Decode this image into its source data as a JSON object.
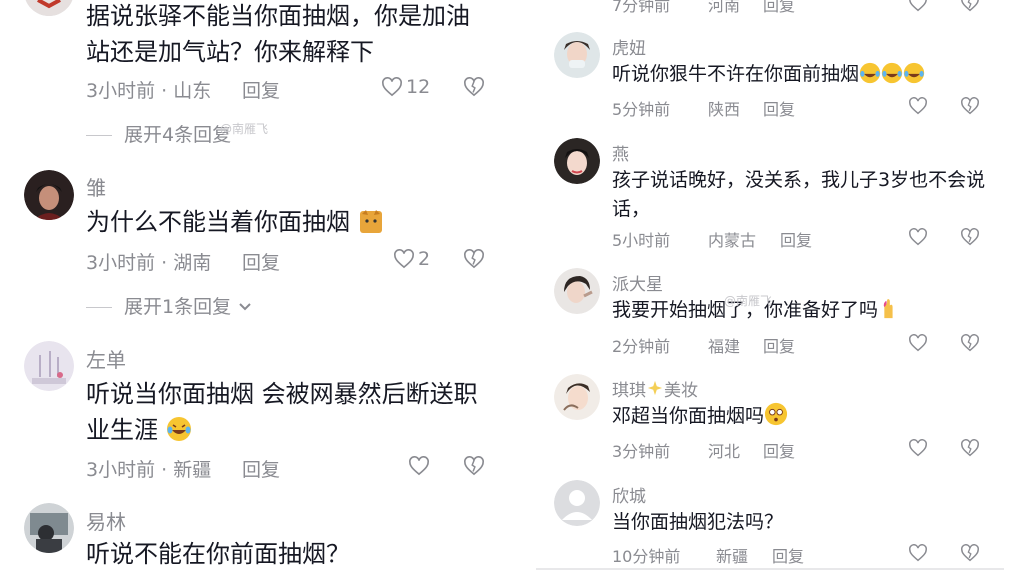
{
  "left": {
    "comments": [
      {
        "name": "",
        "text": "据说张驿不能当你面抽烟，你是加油站还是加气站？你来解释下",
        "time_location": "3小时前 · 山东",
        "reply": "回复",
        "likes": "12",
        "expand": "展开4条回复"
      },
      {
        "name": "雏",
        "text": "为什么不能当着你面抽烟",
        "time_location": "3小时前 · 湖南",
        "reply": "回复",
        "likes": "2",
        "expand": "展开1条回复"
      },
      {
        "name": "左单",
        "text": "听说当你面抽烟 会被网暴然后断送职业生涯",
        "time_location": "3小时前 · 新疆",
        "reply": "回复"
      },
      {
        "name": "易林",
        "text": "听说不能在你前面抽烟？"
      }
    ],
    "watermark": "@南雁飞"
  },
  "right": {
    "top_partial": {
      "time": "7分钟前",
      "location": "河南",
      "reply": "回复"
    },
    "comments": [
      {
        "name": "虎妞",
        "text": "听说你狠牛不许在你面前抽烟",
        "time": "5分钟前",
        "location": "陕西",
        "reply": "回复"
      },
      {
        "name": "燕",
        "text": "孩子说话晚好，没关系，我儿子3岁也不会说话，",
        "time": "5小时前",
        "location": "内蒙古",
        "reply": "回复"
      },
      {
        "name": "派大星",
        "text": "我要开始抽烟了，你准备好了吗",
        "time": "2分钟前",
        "location": "福建",
        "reply": "回复"
      },
      {
        "name": "琪琪",
        "name_suffix": "美妆",
        "text": "邓超当你面抽烟吗",
        "time": "3分钟前",
        "location": "河北",
        "reply": "回复"
      },
      {
        "name": "欣城",
        "text": "当你面抽烟犯法吗？",
        "time": "10分钟前",
        "location": "新疆",
        "reply": "回复"
      }
    ],
    "watermark": "@南雁飞"
  },
  "icons": {
    "like": "heart-outline-icon",
    "dislike": "broken-heart-icon",
    "expand": "chevron-down-icon",
    "emoji_laugh": "tears-of-joy-emoji",
    "emoji_cat": "cat-emoji",
    "emoji_crossed": "crossed-fingers-emoji",
    "emoji_dizzy": "dizzy-face-emoji"
  }
}
